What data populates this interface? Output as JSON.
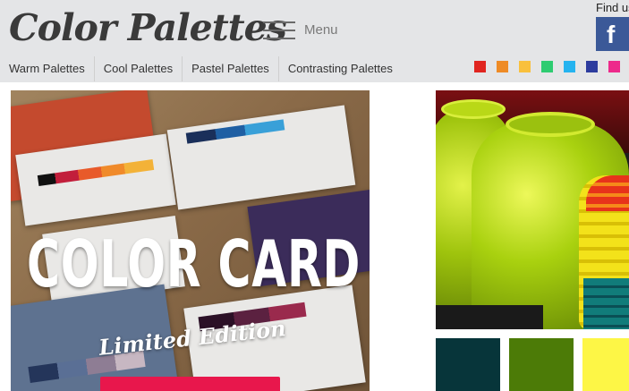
{
  "header": {
    "logo": "Color Palettes",
    "menu_label": "Menu",
    "find_us": "Find us",
    "facebook_glyph": "f"
  },
  "nav": {
    "items": [
      {
        "label": "Warm Palettes"
      },
      {
        "label": "Cool Palettes"
      },
      {
        "label": "Pastel Palettes"
      },
      {
        "label": "Contrasting Palettes"
      }
    ]
  },
  "color_swatches": [
    {
      "name": "red",
      "color": "#e02520"
    },
    {
      "name": "orange",
      "color": "#ee8b26"
    },
    {
      "name": "yellow",
      "color": "#f9c03d"
    },
    {
      "name": "green",
      "color": "#2ecc71"
    },
    {
      "name": "light-blue",
      "color": "#25b3ef"
    },
    {
      "name": "dark-blue",
      "color": "#2d3c9e"
    },
    {
      "name": "pink",
      "color": "#ed2a8b"
    }
  ],
  "featured": {
    "title": "COLOR CARD",
    "subtitle": "Limited Edition"
  },
  "palette_preview": [
    {
      "color": "#07353a"
    },
    {
      "color": "#4c7b07"
    },
    {
      "color": "#fdf646"
    }
  ]
}
